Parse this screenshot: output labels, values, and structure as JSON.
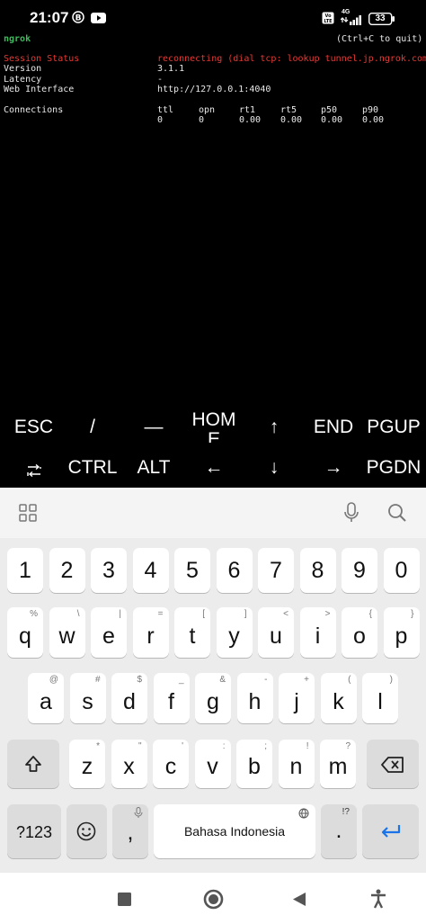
{
  "status_bar": {
    "time": "21:07",
    "volte": "Vo LTE",
    "network": "4G",
    "battery": "33"
  },
  "terminal": {
    "app_name": "ngrok",
    "quit_hint": "(Ctrl+C to quit)",
    "rows": [
      {
        "label": "Session Status",
        "value": "reconnecting (dial tcp: lookup tunnel.jp.ngrok.com",
        "status": "error"
      },
      {
        "label": "Version",
        "value": "3.1.1"
      },
      {
        "label": "Latency",
        "value": "-"
      },
      {
        "label": "Web Interface",
        "value": "http://127.0.0.1:4040"
      }
    ],
    "connections": {
      "label": "Connections",
      "headers": [
        "ttl",
        "opn",
        "rt1",
        "rt5",
        "p50",
        "p90"
      ],
      "values": [
        "0",
        "0",
        "0.00",
        "0.00",
        "0.00",
        "0.00"
      ]
    }
  },
  "extra_keys": {
    "row1": [
      "ESC",
      "/",
      "―",
      "HOME",
      "↑",
      "END",
      "PGUP"
    ],
    "row2": [
      "CTRL",
      "ALT",
      "←",
      "↓",
      "→",
      "PGDN"
    ]
  },
  "keyboard": {
    "number_row": [
      "1",
      "2",
      "3",
      "4",
      "5",
      "6",
      "7",
      "8",
      "9",
      "0"
    ],
    "row1": [
      {
        "k": "q",
        "h": "%"
      },
      {
        "k": "w",
        "h": "\\"
      },
      {
        "k": "e",
        "h": "|"
      },
      {
        "k": "r",
        "h": "="
      },
      {
        "k": "t",
        "h": "["
      },
      {
        "k": "y",
        "h": "]"
      },
      {
        "k": "u",
        "h": "<"
      },
      {
        "k": "i",
        "h": ">"
      },
      {
        "k": "o",
        "h": "{"
      },
      {
        "k": "p",
        "h": "}"
      }
    ],
    "row2": [
      {
        "k": "a",
        "h": "@"
      },
      {
        "k": "s",
        "h": "#"
      },
      {
        "k": "d",
        "h": "$"
      },
      {
        "k": "f",
        "h": "_"
      },
      {
        "k": "g",
        "h": "&"
      },
      {
        "k": "h",
        "h": "-"
      },
      {
        "k": "j",
        "h": "+"
      },
      {
        "k": "k",
        "h": "("
      },
      {
        "k": "l",
        "h": ")"
      }
    ],
    "row3": [
      {
        "k": "z",
        "h": "*"
      },
      {
        "k": "x",
        "h": "\""
      },
      {
        "k": "c",
        "h": "'"
      },
      {
        "k": "v",
        "h": ":"
      },
      {
        "k": "b",
        "h": ";"
      },
      {
        "k": "n",
        "h": "!"
      },
      {
        "k": "m",
        "h": "?"
      }
    ],
    "symbols_label": "?123",
    "comma": ",",
    "space_label": "Bahasa Indonesia",
    "period": ".",
    "period_hint": "!?"
  },
  "colors": {
    "terminal_green": "#3dbb5d",
    "terminal_red": "#e53935",
    "enter_blue": "#1a73e8"
  }
}
